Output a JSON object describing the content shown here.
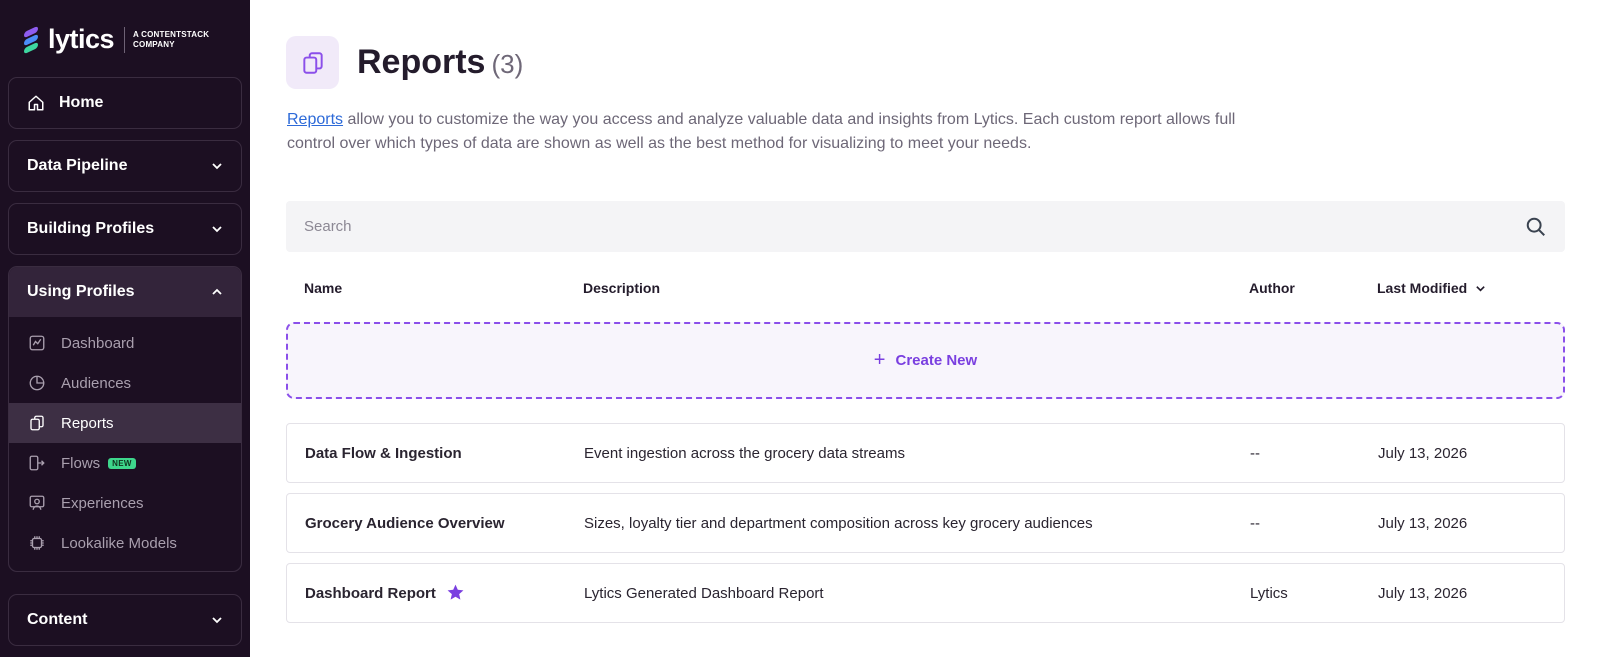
{
  "brand": {
    "name": "lytics",
    "tagline_line1": "A CONTENTSTACK",
    "tagline_line2": "COMPANY"
  },
  "sidebar": {
    "home": "Home",
    "sections": [
      {
        "label": "Data Pipeline",
        "expanded": false
      },
      {
        "label": "Building Profiles",
        "expanded": false
      },
      {
        "label": "Using Profiles",
        "expanded": true
      },
      {
        "label": "Content",
        "expanded": false
      }
    ],
    "using_profiles_items": [
      {
        "label": "Dashboard",
        "icon": "chart-line-icon"
      },
      {
        "label": "Audiences",
        "icon": "pie-chart-icon"
      },
      {
        "label": "Reports",
        "icon": "reports-icon",
        "active": true
      },
      {
        "label": "Flows",
        "icon": "flows-icon",
        "badge": "NEW"
      },
      {
        "label": "Experiences",
        "icon": "experience-icon"
      },
      {
        "label": "Lookalike Models",
        "icon": "chip-icon"
      }
    ]
  },
  "page": {
    "title": "Reports",
    "count": "(3)",
    "intro_link": "Reports",
    "intro_rest": " allow you to customize the way you access and analyze valuable data and insights from Lytics. Each custom report allows full control over which types of data are shown as well as the best method for visualizing to meet your needs."
  },
  "search": {
    "placeholder": "Search"
  },
  "table": {
    "headers": {
      "name": "Name",
      "description": "Description",
      "author": "Author",
      "last_modified": "Last Modified"
    },
    "create_label": "Create New",
    "rows": [
      {
        "name": "Data Flow & Ingestion",
        "description": "Event ingestion across the grocery data streams",
        "author": "--",
        "last_modified": "July 13, 2026",
        "starred": false
      },
      {
        "name": "Grocery Audience Overview",
        "description": "Sizes, loyalty tier and department composition across key grocery audiences",
        "author": "--",
        "last_modified": "July 13, 2026",
        "starred": false
      },
      {
        "name": "Dashboard Report",
        "description": "Lytics Generated Dashboard Report",
        "author": "Lytics",
        "last_modified": "July 13, 2026",
        "starred": true
      }
    ]
  },
  "colors": {
    "sidebar_bg": "#1c0f22",
    "accent": "#7a3fe0",
    "link": "#2d6ad8",
    "badge_green": "#3ed68c"
  }
}
